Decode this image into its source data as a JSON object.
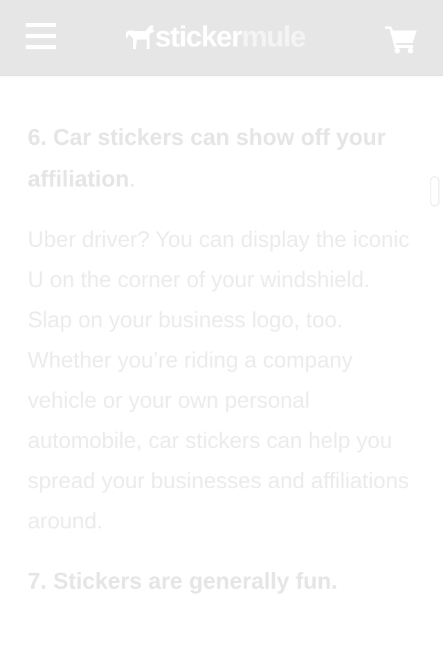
{
  "header": {
    "logo": {
      "part1": "sticker",
      "part2": "mule"
    },
    "menu_icon": "hamburger-menu-icon",
    "cart_icon": "shopping-cart-icon"
  },
  "article": {
    "heading6": {
      "text": "6. Car stickers can show off your affiliation",
      "trailing": "."
    },
    "paragraph": "Uber driver? You can display the iconic U on the corner of your windshield. Slap on your business logo, too. Whether you’re riding a company vehicle or your own personal automobile, car stickers can help you spread your businesses and affiliations around.",
    "heading7": "7. Stickers are generally fun."
  },
  "colors": {
    "header_bg": "#e6e6e6",
    "header_fg": "#ffffff",
    "text_faded": "#ebebeb"
  }
}
